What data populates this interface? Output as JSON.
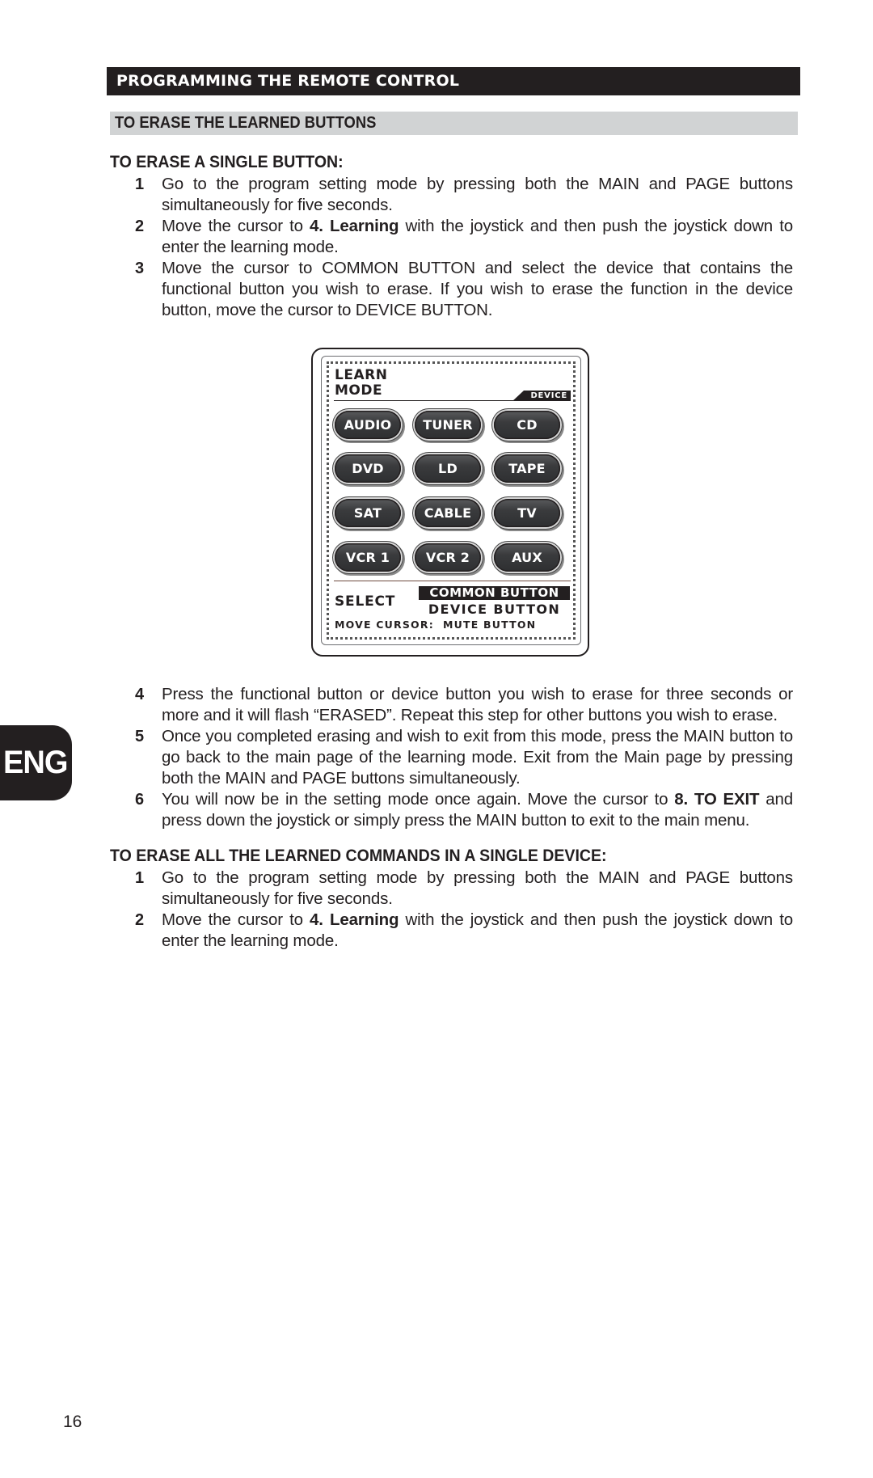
{
  "header": {
    "title": "PROGRAMMING THE REMOTE CONTROL",
    "subtitle": "TO ERASE THE LEARNED BUTTONS"
  },
  "section_single": {
    "heading": "TO ERASE A SINGLE BUTTON:",
    "steps": [
      {
        "num": "1",
        "html_parts": [
          {
            "t": "Go to the program setting mode by pressing both the MAIN and PAGE buttons simultaneously for five seconds."
          }
        ]
      },
      {
        "num": "2",
        "html_parts": [
          {
            "t": "Move the cursor to "
          },
          {
            "t": "4. Learning",
            "b": true
          },
          {
            "t": " with the joystick and then push the joystick down to enter the learning mode."
          }
        ]
      },
      {
        "num": "3",
        "html_parts": [
          {
            "t": "Move the cursor to COMMON BUTTON and select the device that contains the functional button you wish to erase. If you wish to erase the function in the device button, move the cursor to DEVICE BUTTON."
          }
        ]
      }
    ],
    "steps_after": [
      {
        "num": "4",
        "html_parts": [
          {
            "t": "Press the functional button or device button you wish to erase for three seconds or more and it will flash “ERASED”. Repeat this step for other buttons you wish to erase."
          }
        ]
      },
      {
        "num": "5",
        "html_parts": [
          {
            "t": "Once you completed erasing and wish to exit from this mode, press the MAIN button to go back to the main page of the learning mode. Exit from the Main page by pressing both the MAIN and PAGE buttons simultaneously."
          }
        ]
      },
      {
        "num": "6",
        "html_parts": [
          {
            "t": "You will now be in the setting mode once again. Move the cursor to "
          },
          {
            "t": "8. TO EXIT",
            "b": true
          },
          {
            "t": " and press down the joystick or simply press the MAIN button to exit to the main menu."
          }
        ]
      }
    ]
  },
  "section_all": {
    "heading": "TO ERASE ALL THE LEARNED COMMANDS IN A SINGLE DEVICE:",
    "steps": [
      {
        "num": "1",
        "html_parts": [
          {
            "t": "Go to the program setting mode by pressing both the MAIN and PAGE buttons simultaneously for five seconds."
          }
        ]
      },
      {
        "num": "2",
        "html_parts": [
          {
            "t": "Move the cursor to "
          },
          {
            "t": "4. Learning",
            "b": true
          },
          {
            "t": " with the joystick and then push the joystick down to enter the learning mode."
          }
        ]
      }
    ]
  },
  "lcd": {
    "title_line1": "LEARN",
    "title_line2": "MODE",
    "device_tag": "DEVICE",
    "buttons": [
      [
        "AUDIO",
        "TUNER",
        "CD"
      ],
      [
        "DVD",
        "LD",
        "TAPE"
      ],
      [
        "SAT",
        "CABLE",
        "TV"
      ],
      [
        "VCR 1",
        "VCR 2",
        "AUX"
      ]
    ],
    "select_label": "SELECT",
    "common_button": "COMMON BUTTON",
    "device_button": "DEVICE BUTTON",
    "move_cursor": "MOVE CURSOR:  MUTE BUTTON"
  },
  "language_tab": "ENG",
  "page_number": "16"
}
